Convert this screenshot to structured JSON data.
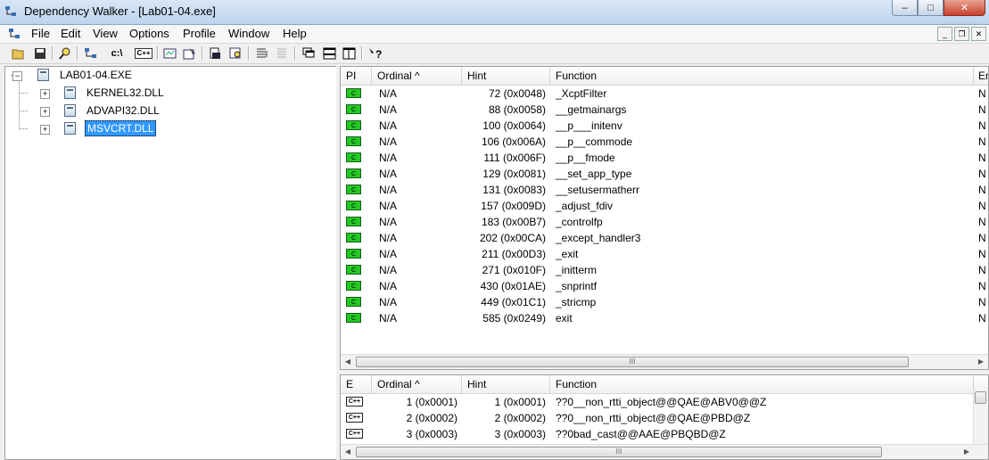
{
  "window": {
    "title": "Dependency Walker - [Lab01-04.exe]",
    "minimize": "–",
    "maximize": "□",
    "close": "✕"
  },
  "menu": [
    "File",
    "Edit",
    "View",
    "Options",
    "Profile",
    "Window",
    "Help"
  ],
  "mdi_controls": [
    "_",
    "❐",
    "✕"
  ],
  "toolbar": {
    "icons": [
      "open-icon",
      "save-icon",
      "find-icon",
      "configure-search-paths-icon",
      "full-paths-icon",
      "undecorate-cpp-icon",
      "view-module-icon",
      "properties-icon",
      "copy-icon",
      "find-module-icon",
      "expand-all-icon",
      "collapse-all-icon",
      "cascade-icon",
      "tile-horizontal-icon",
      "tile-vertical-icon",
      "help-icon"
    ],
    "text_buttons": {
      "full_paths": "c:\\",
      "cpp": "C++"
    }
  },
  "tree": {
    "root": "LAB01-04.EXE",
    "children": [
      "KERNEL32.DLL",
      "ADVAPI32.DLL",
      "MSVCRT.DLL"
    ],
    "expander_closed": "+",
    "expander_open": "−"
  },
  "imports": {
    "headers": [
      "PI",
      "Ordinal ^",
      "Hint",
      "Function",
      "En"
    ],
    "pi_glyph": "C",
    "rows": [
      {
        "ordinal": "N/A",
        "hint": "72 (0x0048)",
        "function": "_XcptFilter",
        "entry": "N"
      },
      {
        "ordinal": "N/A",
        "hint": "88 (0x0058)",
        "function": "__getmainargs",
        "entry": "N"
      },
      {
        "ordinal": "N/A",
        "hint": "100 (0x0064)",
        "function": "__p___initenv",
        "entry": "N"
      },
      {
        "ordinal": "N/A",
        "hint": "106 (0x006A)",
        "function": "__p__commode",
        "entry": "N"
      },
      {
        "ordinal": "N/A",
        "hint": "111 (0x006F)",
        "function": "__p__fmode",
        "entry": "N"
      },
      {
        "ordinal": "N/A",
        "hint": "129 (0x0081)",
        "function": "__set_app_type",
        "entry": "N"
      },
      {
        "ordinal": "N/A",
        "hint": "131 (0x0083)",
        "function": "__setusermatherr",
        "entry": "N"
      },
      {
        "ordinal": "N/A",
        "hint": "157 (0x009D)",
        "function": "_adjust_fdiv",
        "entry": "N"
      },
      {
        "ordinal": "N/A",
        "hint": "183 (0x00B7)",
        "function": "_controlfp",
        "entry": "N"
      },
      {
        "ordinal": "N/A",
        "hint": "202 (0x00CA)",
        "function": "_except_handler3",
        "entry": "N"
      },
      {
        "ordinal": "N/A",
        "hint": "211 (0x00D3)",
        "function": "_exit",
        "entry": "N"
      },
      {
        "ordinal": "N/A",
        "hint": "271 (0x010F)",
        "function": "_initterm",
        "entry": "N"
      },
      {
        "ordinal": "N/A",
        "hint": "430 (0x01AE)",
        "function": "_snprintf",
        "entry": "N"
      },
      {
        "ordinal": "N/A",
        "hint": "449 (0x01C1)",
        "function": "_stricmp",
        "entry": "N"
      },
      {
        "ordinal": "N/A",
        "hint": "585 (0x0249)",
        "function": "exit",
        "entry": "N"
      }
    ],
    "scroll_grip": "III"
  },
  "exports": {
    "headers": [
      "E",
      "Ordinal ^",
      "Hint",
      "Function"
    ],
    "e_glyph": "C++",
    "rows": [
      {
        "ordinal": "1 (0x0001)",
        "hint": "1 (0x0001)",
        "function": "??0__non_rtti_object@@QAE@ABV0@@Z"
      },
      {
        "ordinal": "2 (0x0002)",
        "hint": "2 (0x0002)",
        "function": "??0__non_rtti_object@@QAE@PBD@Z"
      },
      {
        "ordinal": "3 (0x0003)",
        "hint": "3 (0x0003)",
        "function": "??0bad_cast@@AAE@PBQBD@Z"
      }
    ],
    "scroll_grip": "III"
  }
}
